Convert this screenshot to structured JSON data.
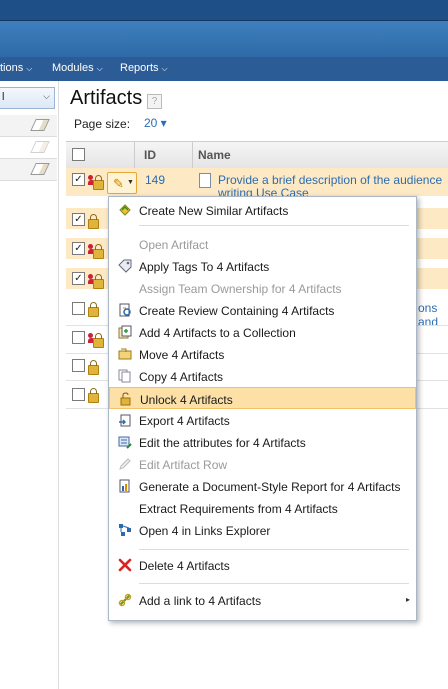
{
  "nav": {
    "items": [
      {
        "label": "tions",
        "chev": "⌵"
      },
      {
        "label": "Modules",
        "chev": "⌵"
      },
      {
        "label": "Reports",
        "chev": "⌵"
      }
    ]
  },
  "left": {
    "select_value": "l"
  },
  "page": {
    "title": "Artifacts",
    "help": "?",
    "page_size_label": "Page size:",
    "page_size_value": "20 ▾"
  },
  "table": {
    "headers": {
      "id": "ID",
      "name": "Name"
    },
    "first_row": {
      "id": "149",
      "name_line1": "Provide a brief description of the audience",
      "name_line2": "writing Use Case"
    },
    "peek_text": "ons and"
  },
  "menu": {
    "items": [
      {
        "label": "Create New Similar Artifacts",
        "icon": "similar-icon",
        "disabled": false
      },
      {
        "label": "Open Artifact",
        "disabled": true
      },
      {
        "label": "Apply Tags To 4 Artifacts",
        "icon": "tag-icon",
        "disabled": false
      },
      {
        "label": "Assign Team Ownership for 4 Artifacts",
        "disabled": true
      },
      {
        "label": "Create Review Containing 4 Artifacts",
        "icon": "review-icon",
        "disabled": false
      },
      {
        "label": "Add 4 Artifacts to a Collection",
        "icon": "collection-icon",
        "disabled": false
      },
      {
        "label": "Move 4 Artifacts",
        "icon": "move-icon",
        "disabled": false
      },
      {
        "label": "Copy 4 Artifacts",
        "icon": "copy-icon",
        "disabled": false
      },
      {
        "label": "Unlock 4 Artifacts",
        "icon": "unlock-icon",
        "disabled": false,
        "highlighted": true
      },
      {
        "label": "Export 4 Artifacts",
        "icon": "export-icon",
        "disabled": false
      },
      {
        "label": "Edit the attributes for 4 Artifacts",
        "icon": "edit-attributes-icon",
        "disabled": false
      },
      {
        "label": "Edit Artifact Row",
        "icon": "pencil-icon",
        "disabled": true
      },
      {
        "label": "Generate a Document-Style Report for 4 Artifacts",
        "icon": "report-icon",
        "disabled": false
      },
      {
        "label": "Extract Requirements from 4 Artifacts",
        "disabled": false
      },
      {
        "label": "Open 4 in Links Explorer",
        "icon": "links-explorer-icon",
        "disabled": false
      },
      {
        "label": "Delete 4 Artifacts",
        "icon": "delete-icon",
        "disabled": false
      },
      {
        "label": "Add a link to 4 Artifacts",
        "icon": "link-icon",
        "disabled": false,
        "submenu": "▸"
      }
    ]
  },
  "colors": {
    "nav_bg": "#2c5c95",
    "highlight": "#fde0a6",
    "link": "#2b6db3",
    "selected_row": "#fde9c4"
  }
}
